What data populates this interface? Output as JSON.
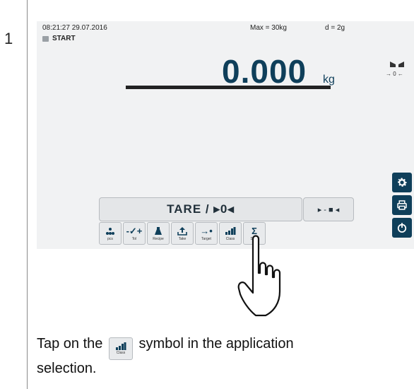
{
  "step": {
    "number": "1"
  },
  "screen": {
    "datetime": "08:21:27 29.07.2016",
    "status": "START",
    "max": "Max = 30kg",
    "d": "d = 2g",
    "weight": "0.000",
    "unit": "kg",
    "zero_indicator": "→ 0 ←",
    "tare_label": "TARE / ▸0◂",
    "zero_button_label": "▸ - ■ ◂",
    "apps": [
      {
        "label": "pcs",
        "icon": "pieces-icon"
      },
      {
        "label": "Tol",
        "icon": "tolerance-icon"
      },
      {
        "label": "Recipe",
        "icon": "recipe-icon"
      },
      {
        "label": "Take",
        "icon": "take-icon"
      },
      {
        "label": "Target",
        "icon": "target-icon"
      },
      {
        "label": "Class",
        "icon": "class-icon"
      },
      {
        "label": "SUM",
        "icon": "sum-icon"
      }
    ],
    "side_buttons": [
      "gear-icon",
      "printer-icon",
      "power-icon"
    ],
    "colors": {
      "accent": "#0f3f5a",
      "screen_bg": "#f1f2f3",
      "button_bg": "#e4e6e8"
    }
  },
  "instruction": {
    "before": "Tap on the",
    "icon_label": "Class",
    "after": "symbol in the application selection."
  }
}
